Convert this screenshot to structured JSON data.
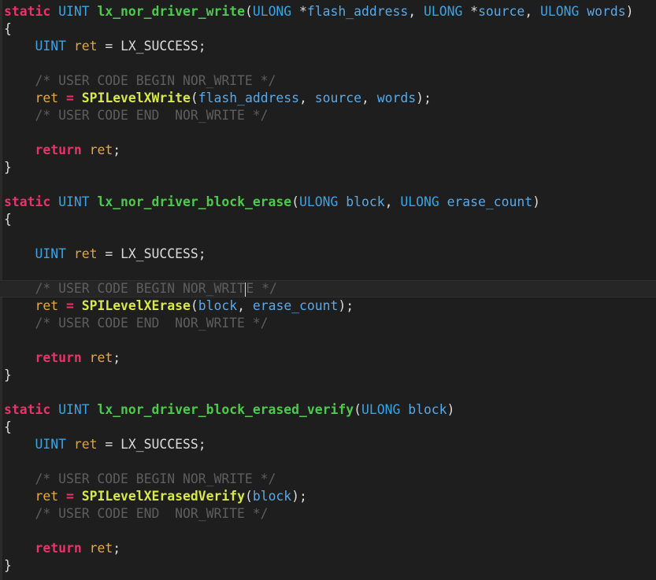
{
  "editor": {
    "lines": [
      [
        [
          "kw",
          "static"
        ],
        [
          "plain",
          " "
        ],
        [
          "type",
          "UINT"
        ],
        [
          "plain",
          " "
        ],
        [
          "func",
          "lx_nor_driver_write"
        ],
        [
          "punct",
          "("
        ],
        [
          "type",
          "ULONG"
        ],
        [
          "plain",
          " *"
        ],
        [
          "param",
          "flash_address"
        ],
        [
          "punct",
          ", "
        ],
        [
          "type",
          "ULONG"
        ],
        [
          "plain",
          " *"
        ],
        [
          "param",
          "source"
        ],
        [
          "punct",
          ", "
        ],
        [
          "type",
          "ULONG"
        ],
        [
          "plain",
          " "
        ],
        [
          "param",
          "words"
        ],
        [
          "punct",
          ")"
        ]
      ],
      [
        [
          "punct",
          "{"
        ]
      ],
      [
        [
          "plain",
          "    "
        ],
        [
          "type",
          "UINT"
        ],
        [
          "plain",
          " "
        ],
        [
          "var",
          "ret"
        ],
        [
          "plain",
          " = "
        ],
        [
          "const",
          "LX_SUCCESS"
        ],
        [
          "punct",
          ";"
        ]
      ],
      [],
      [
        [
          "plain",
          "    "
        ],
        [
          "comment",
          "/* USER CODE BEGIN NOR_WRITE */"
        ]
      ],
      [
        [
          "plain",
          "    "
        ],
        [
          "ret",
          "ret"
        ],
        [
          "plain",
          " "
        ],
        [
          "op",
          "="
        ],
        [
          "plain",
          " "
        ],
        [
          "call",
          "SPILevelXWrite"
        ],
        [
          "punct",
          "("
        ],
        [
          "param",
          "flash_address"
        ],
        [
          "punct",
          ", "
        ],
        [
          "param",
          "source"
        ],
        [
          "punct",
          ", "
        ],
        [
          "param",
          "words"
        ],
        [
          "punct",
          ");"
        ]
      ],
      [
        [
          "plain",
          "    "
        ],
        [
          "comment",
          "/* USER CODE END  NOR_WRITE */"
        ]
      ],
      [],
      [
        [
          "plain",
          "    "
        ],
        [
          "kw",
          "return"
        ],
        [
          "plain",
          " "
        ],
        [
          "ret",
          "ret"
        ],
        [
          "punct",
          ";"
        ]
      ],
      [
        [
          "punct",
          "}"
        ]
      ],
      [],
      [
        [
          "kw",
          "static"
        ],
        [
          "plain",
          " "
        ],
        [
          "type",
          "UINT"
        ],
        [
          "plain",
          " "
        ],
        [
          "func",
          "lx_nor_driver_block_erase"
        ],
        [
          "punct",
          "("
        ],
        [
          "type",
          "ULONG"
        ],
        [
          "plain",
          " "
        ],
        [
          "param",
          "block"
        ],
        [
          "punct",
          ", "
        ],
        [
          "type",
          "ULONG"
        ],
        [
          "plain",
          " "
        ],
        [
          "param",
          "erase_count"
        ],
        [
          "punct",
          ")"
        ]
      ],
      [
        [
          "punct",
          "{"
        ]
      ],
      [],
      [
        [
          "plain",
          "    "
        ],
        [
          "type",
          "UINT"
        ],
        [
          "plain",
          " "
        ],
        [
          "var",
          "ret"
        ],
        [
          "plain",
          " = "
        ],
        [
          "const",
          "LX_SUCCESS"
        ],
        [
          "punct",
          ";"
        ]
      ],
      [],
      [
        [
          "plain",
          "    "
        ],
        [
          "comment",
          "/* USER CODE BEGIN NOR_WRIT"
        ],
        [
          "caret",
          ""
        ],
        [
          "comment",
          "E */"
        ]
      ],
      [
        [
          "plain",
          "    "
        ],
        [
          "ret",
          "ret"
        ],
        [
          "plain",
          " "
        ],
        [
          "op",
          "="
        ],
        [
          "plain",
          " "
        ],
        [
          "call",
          "SPILevelXErase"
        ],
        [
          "punct",
          "("
        ],
        [
          "param",
          "block"
        ],
        [
          "punct",
          ", "
        ],
        [
          "param",
          "erase_count"
        ],
        [
          "punct",
          ");"
        ]
      ],
      [
        [
          "plain",
          "    "
        ],
        [
          "comment",
          "/* USER CODE END  NOR_WRITE */"
        ]
      ],
      [],
      [
        [
          "plain",
          "    "
        ],
        [
          "kw",
          "return"
        ],
        [
          "plain",
          " "
        ],
        [
          "ret",
          "ret"
        ],
        [
          "punct",
          ";"
        ]
      ],
      [
        [
          "punct",
          "}"
        ]
      ],
      [],
      [
        [
          "kw",
          "static"
        ],
        [
          "plain",
          " "
        ],
        [
          "type",
          "UINT"
        ],
        [
          "plain",
          " "
        ],
        [
          "func",
          "lx_nor_driver_block_erased_verify"
        ],
        [
          "punct",
          "("
        ],
        [
          "type",
          "ULONG"
        ],
        [
          "plain",
          " "
        ],
        [
          "param",
          "block"
        ],
        [
          "punct",
          ")"
        ]
      ],
      [
        [
          "punct",
          "{"
        ]
      ],
      [
        [
          "plain",
          "    "
        ],
        [
          "type",
          "UINT"
        ],
        [
          "plain",
          " "
        ],
        [
          "var",
          "ret"
        ],
        [
          "plain",
          " = "
        ],
        [
          "const",
          "LX_SUCCESS"
        ],
        [
          "punct",
          ";"
        ]
      ],
      [],
      [
        [
          "plain",
          "    "
        ],
        [
          "comment",
          "/* USER CODE BEGIN NOR_WRITE */"
        ]
      ],
      [
        [
          "plain",
          "    "
        ],
        [
          "ret",
          "ret"
        ],
        [
          "plain",
          " "
        ],
        [
          "op",
          "="
        ],
        [
          "plain",
          " "
        ],
        [
          "call",
          "SPILevelXErasedVerify"
        ],
        [
          "punct",
          "("
        ],
        [
          "param",
          "block"
        ],
        [
          "punct",
          ");"
        ]
      ],
      [
        [
          "plain",
          "    "
        ],
        [
          "comment",
          "/* USER CODE END  NOR_WRITE */"
        ]
      ],
      [],
      [
        [
          "plain",
          "    "
        ],
        [
          "kw",
          "return"
        ],
        [
          "plain",
          " "
        ],
        [
          "ret",
          "ret"
        ],
        [
          "punct",
          ";"
        ]
      ],
      [
        [
          "punct",
          "}"
        ]
      ]
    ],
    "current_line": 16
  },
  "colors": {
    "background": "#1e1e1e",
    "keyword": "#e8336b",
    "type": "#3aa3e3",
    "function": "#4ec94e",
    "call": "#d7e84a",
    "comment": "#5e5e5e"
  }
}
